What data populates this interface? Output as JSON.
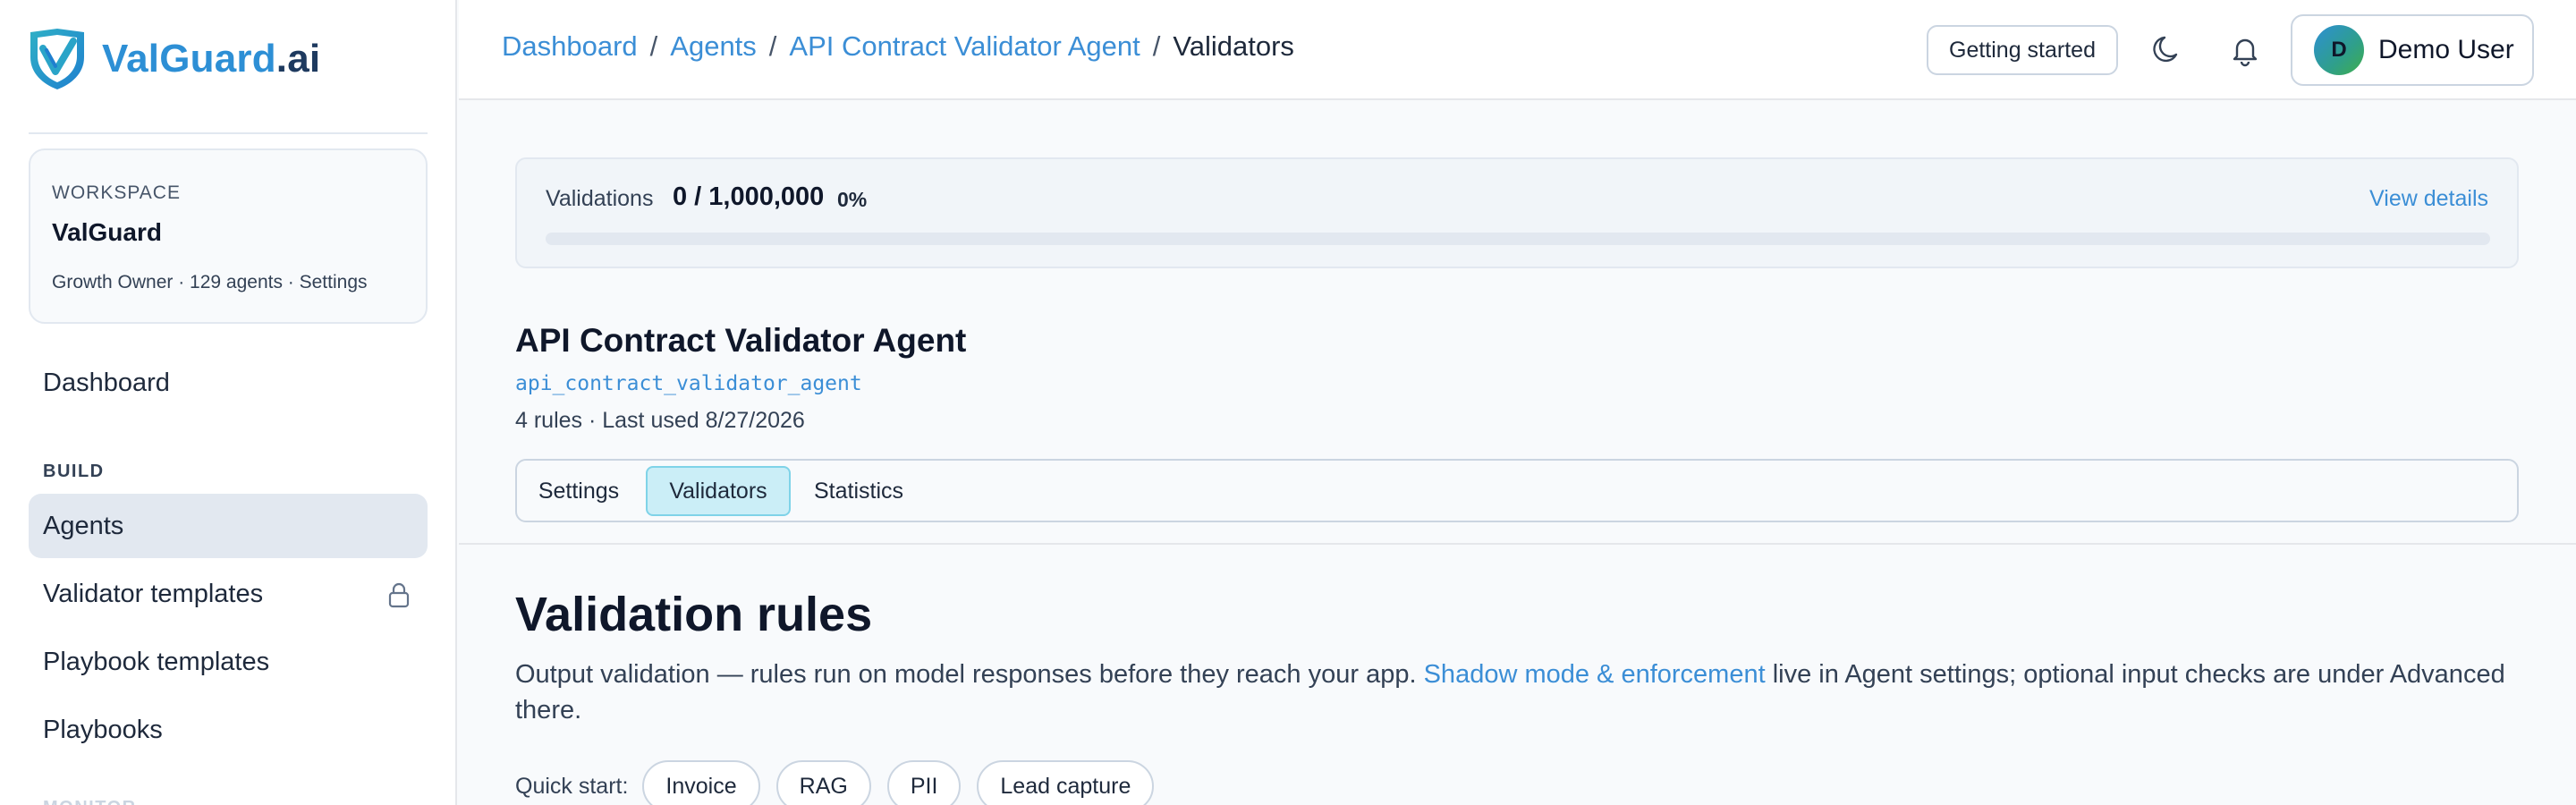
{
  "app": {
    "logo": {
      "part1": "ValGuard",
      "part2": ".ai"
    }
  },
  "workspace": {
    "label": "WORKSPACE",
    "name": "ValGuard",
    "meta": "Growth Owner · 129 agents · Settings"
  },
  "sidebar": {
    "dashboard": "Dashboard",
    "build_section": "BUILD",
    "items": [
      {
        "label": "Agents",
        "active": true
      },
      {
        "label": "Validator templates",
        "locked": true
      },
      {
        "label": "Playbook templates"
      },
      {
        "label": "Playbooks"
      }
    ],
    "next_section": "MONITOR"
  },
  "header": {
    "breadcrumb": [
      "Dashboard",
      "Agents",
      "API Contract Validator Agent",
      "Validators"
    ],
    "separator": "/",
    "getting_started": "Getting started",
    "user": {
      "initial": "D",
      "name": "Demo User"
    }
  },
  "usage": {
    "label": "Validations",
    "count": "0 / 1,000,000",
    "percent": "0%",
    "fraction": 0,
    "link": "View details"
  },
  "agent": {
    "title": "API Contract Validator Agent",
    "slug": "api_contract_validator_agent",
    "meta": "4 rules · Last used 8/27/2026"
  },
  "tabs": [
    {
      "label": "Settings",
      "active": false
    },
    {
      "label": "Validators",
      "active": true
    },
    {
      "label": "Statistics",
      "active": false
    }
  ],
  "rules": {
    "title": "Validation rules",
    "desc_before": "Output validation — rules run on model responses before they reach your app. ",
    "desc_link": "Shadow mode & enforcement",
    "desc_after": " live in Agent settings; optional input checks are under Advanced there.",
    "quick_start_label": "Quick start:",
    "quick_start": [
      "Invoice",
      "RAG",
      "PII",
      "Lead capture"
    ]
  },
  "colors": {
    "accent": "#3b8ed6",
    "brand_green": "#3fae4a",
    "active_tab_bg": "#cbeef7",
    "active_nav_bg": "#e2e8f0"
  },
  "icons": {
    "logo": "shield-check-icon",
    "theme": "moon-icon",
    "notifications": "bell-icon",
    "lock": "lock-icon"
  }
}
